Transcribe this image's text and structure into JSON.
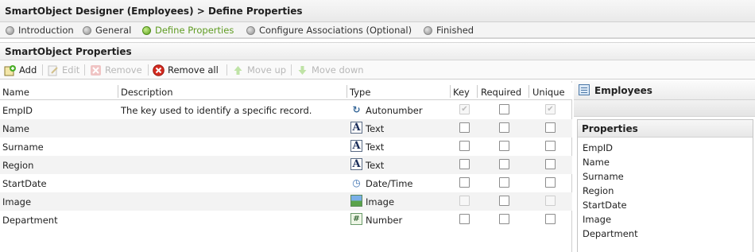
{
  "title": "SmartObject Designer (Employees) > Define Properties",
  "steps": [
    {
      "label": "Introduction",
      "active": false
    },
    {
      "label": "General",
      "active": false
    },
    {
      "label": "Define Properties",
      "active": true
    },
    {
      "label": "Configure Associations (Optional)",
      "active": false
    },
    {
      "label": "Finished",
      "active": false
    }
  ],
  "section_title": "SmartObject Properties",
  "toolbar": {
    "add": "Add",
    "edit": "Edit",
    "remove": "Remove",
    "remove_all": "Remove all",
    "move_up": "Move up",
    "move_down": "Move down"
  },
  "columns": {
    "name": "Name",
    "description": "Description",
    "type": "Type",
    "key": "Key",
    "required": "Required",
    "unique": "Unique"
  },
  "rows": [
    {
      "name": "EmpID",
      "description": "The key used to identify a specific record.",
      "type": "Autonumber",
      "type_icon": "autonumber-icon",
      "key": true,
      "key_disabled": true,
      "required": false,
      "unique": true,
      "unique_disabled": true
    },
    {
      "name": "Name",
      "description": "",
      "type": "Text",
      "type_icon": "text-type-icon",
      "key": false,
      "key_disabled": false,
      "required": false,
      "unique": false,
      "unique_disabled": false
    },
    {
      "name": "Surname",
      "description": "",
      "type": "Text",
      "type_icon": "text-type-icon",
      "key": false,
      "key_disabled": false,
      "required": false,
      "unique": false,
      "unique_disabled": false
    },
    {
      "name": "Region",
      "description": "",
      "type": "Text",
      "type_icon": "text-type-icon",
      "key": false,
      "key_disabled": false,
      "required": false,
      "unique": false,
      "unique_disabled": false
    },
    {
      "name": "StartDate",
      "description": "",
      "type": "Date/Time",
      "type_icon": "datetime-type-icon",
      "key": false,
      "key_disabled": false,
      "required": false,
      "unique": false,
      "unique_disabled": false
    },
    {
      "name": "Image",
      "description": "",
      "type": "Image",
      "type_icon": "image-type-icon",
      "key": false,
      "key_disabled": true,
      "required": false,
      "unique": false,
      "unique_disabled": true
    },
    {
      "name": "Department",
      "description": "",
      "type": "Number",
      "type_icon": "number-type-icon",
      "key": false,
      "key_disabled": false,
      "required": false,
      "unique": false,
      "unique_disabled": false
    }
  ],
  "side": {
    "title": "Employees",
    "properties_label": "Properties",
    "properties": [
      "EmpID",
      "Name",
      "Surname",
      "Region",
      "StartDate",
      "Image",
      "Department"
    ]
  },
  "colors": {
    "active_step": "#5f9c22",
    "border": "#cfcfcf"
  }
}
